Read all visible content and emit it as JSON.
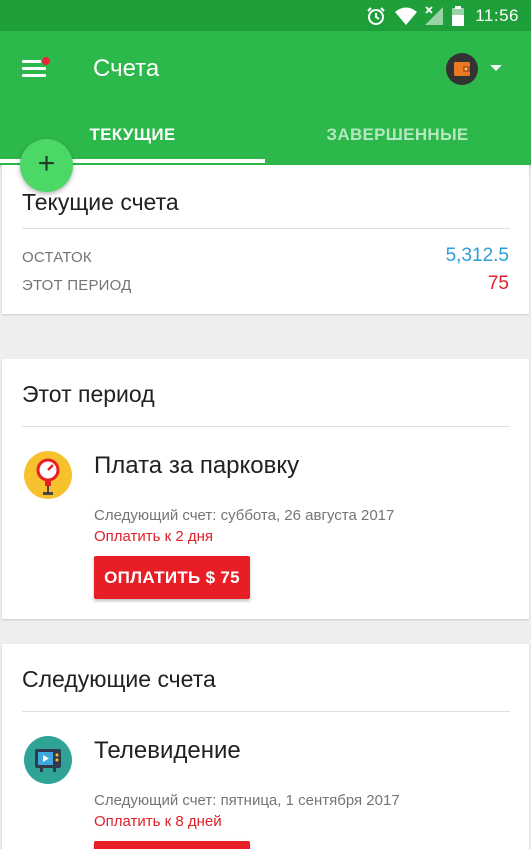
{
  "status_bar": {
    "time": "11:56",
    "icons": [
      "alarm-icon",
      "wifi-icon",
      "signal-icon",
      "battery-icon"
    ]
  },
  "app_bar": {
    "title": "Счета",
    "menu_icon": "hamburger-menu-icon",
    "account_icon": "wallet-icon",
    "accent_color": "#2db84b",
    "status_color": "#1e9f3a"
  },
  "tabs": [
    {
      "label": "ТЕКУЩИЕ",
      "selected": true
    },
    {
      "label": "ЗАВЕРШЕННЫЕ",
      "selected": false
    }
  ],
  "fab": {
    "label": "+",
    "icon": "plus-icon"
  },
  "summary": {
    "title": "Текущие счета",
    "rows": [
      {
        "label": "ОСТАТОК",
        "value": "5,312.5",
        "color": "#2b9fd8"
      },
      {
        "label": "ЭТОТ ПЕРИОД",
        "value": "75",
        "color": "#e0202b"
      }
    ]
  },
  "this_period": {
    "title": "Этот период",
    "bill": {
      "name": "Плата за парковку",
      "icon": "parking-meter-icon",
      "next": "Следующий счет: суббота, 26 августа 2017",
      "due": "Оплатить к 2 дня",
      "button": "ОПЛАТИТЬ $ 75"
    }
  },
  "upcoming": {
    "title": "Следующие счета",
    "bill": {
      "name": "Телевидение",
      "icon": "tv-icon",
      "next": "Следующий счет: пятница, 1 сентября 2017",
      "due": "Оплатить к 8 дней"
    }
  }
}
